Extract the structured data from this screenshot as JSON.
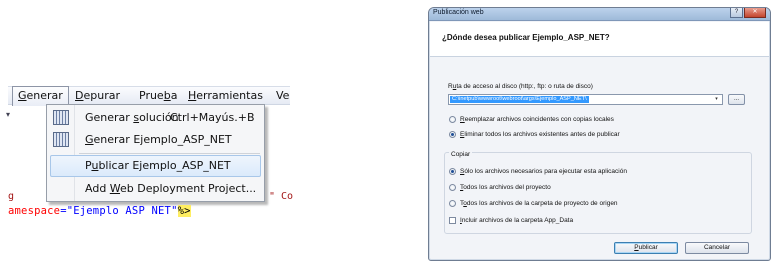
{
  "menubar": {
    "items": [
      {
        "label_pre": "",
        "label_ul": "G",
        "label_post": "enerar"
      },
      {
        "label_pre": "",
        "label_ul": "D",
        "label_post": "epurar"
      },
      {
        "label_pre": "Prue",
        "label_ul": "b",
        "label_post": "a"
      },
      {
        "label_pre": "",
        "label_ul": "H",
        "label_post": "erramientas"
      },
      {
        "label_pre": "Ve",
        "label_ul": "",
        "label_post": ""
      }
    ]
  },
  "menu": {
    "items": [
      {
        "pre": "Generar ",
        "ul": "s",
        "post": "olución",
        "shortcut": "Ctrl+Mayús.+B",
        "icon": "build-solution-icon"
      },
      {
        "pre": "",
        "ul": "G",
        "post": "enerar Ejemplo_ASP_NET",
        "shortcut": "",
        "icon": "build-project-icon"
      },
      {
        "pre": "P",
        "ul": "u",
        "post": "blicar Ejemplo_ASP_NET",
        "shortcut": "",
        "icon": ""
      },
      {
        "pre": "Add ",
        "ul": "W",
        "post": "eb Deployment Project...",
        "shortcut": "",
        "icon": ""
      }
    ]
  },
  "code": {
    "line1_left": "g",
    "line1_right": "\" Co",
    "line2_attr": "amespace",
    "line2_eq": "=",
    "line2_val": "\"Ejemplo ASP NET\"",
    "line2_tag": "%>"
  },
  "dialog": {
    "title": "Publicación web",
    "question": "¿Dónde desea publicar Ejemplo_ASP_NET?",
    "path_label_pre": "R",
    "path_label_ul": "u",
    "path_label_post": "ta de acceso al disco (http:, ftp: o ruta de disco)",
    "path_value": "C:\\inetpub\\wwwroot\\webroot\\args\\Ejemplo_ASP_NET\\",
    "browse_label": "...",
    "dropdown_glyph": "▾",
    "opt_replace": {
      "pre": "",
      "ul": "R",
      "post": "eemplazar archivos coincidentes con copias locales"
    },
    "opt_delete": {
      "pre": "",
      "ul": "E",
      "post": "liminar todos los archivos existentes antes de publicar"
    },
    "copy_label": "Copiar",
    "copy_opt1": {
      "pre": "",
      "ul": "S",
      "post": "ólo los archivos necesarios para ejecutar esta aplicación"
    },
    "copy_opt2": {
      "pre": "",
      "ul": "T",
      "post": "odos los archivos del proyecto"
    },
    "copy_opt3": {
      "pre": "T",
      "ul": "o",
      "post": "dos los archivos de la carpeta de proyecto de origen"
    },
    "include_label": {
      "pre": "",
      "ul": "I",
      "post": "ncluir archivos de la carpeta App_Data"
    },
    "publish_btn": {
      "pre": "",
      "ul": "P",
      "post": "ublicar"
    },
    "cancel_btn": "Cancelar"
  }
}
